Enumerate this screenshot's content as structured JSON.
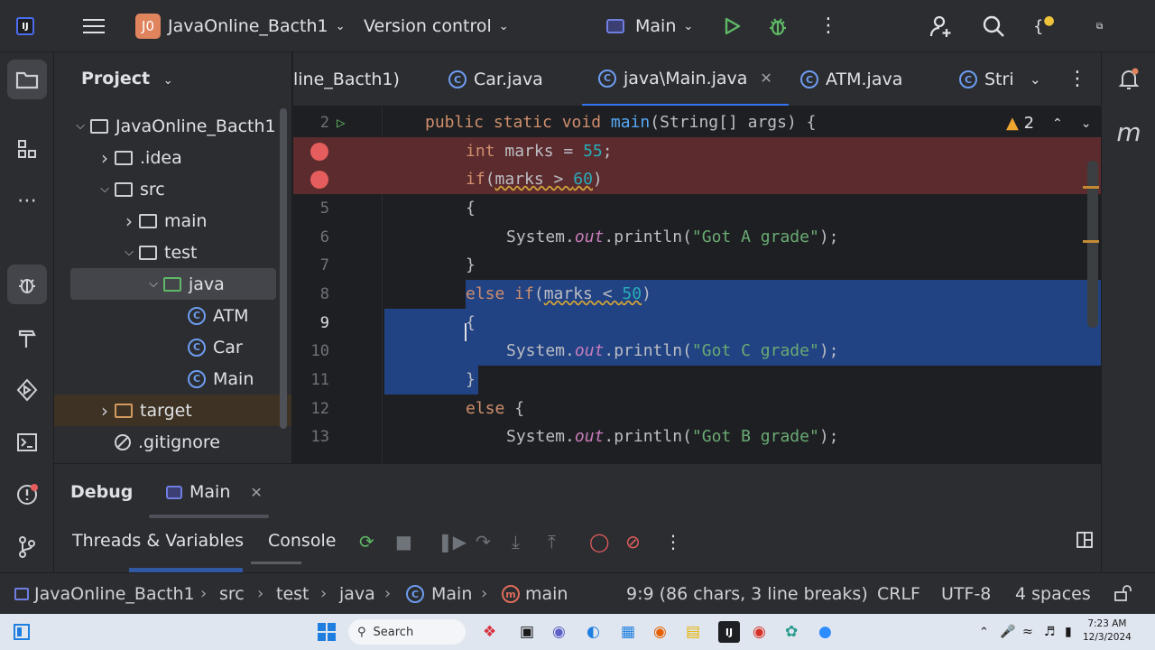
{
  "titlebar": {
    "app_icon_label": "IJ",
    "project_badge": "J0",
    "project_name": "JavaOnline_Bacth1",
    "version_control": "Version control",
    "run_config": "Main"
  },
  "project_panel": {
    "title": "Project",
    "tree": [
      {
        "label": "JavaOnline_Bacth1",
        "type": "folder-root",
        "expanded": true,
        "indent": 0
      },
      {
        "label": ".idea",
        "type": "folder",
        "expanded": false,
        "indent": 1
      },
      {
        "label": "src",
        "type": "folder",
        "expanded": true,
        "indent": 1
      },
      {
        "label": "main",
        "type": "folder",
        "expanded": false,
        "indent": 2
      },
      {
        "label": "test",
        "type": "folder",
        "expanded": true,
        "indent": 2
      },
      {
        "label": "java",
        "type": "folder-green",
        "expanded": true,
        "indent": 3,
        "selected": true
      },
      {
        "label": "ATM",
        "type": "class",
        "indent": 4
      },
      {
        "label": "Car",
        "type": "class",
        "indent": 4
      },
      {
        "label": "Main",
        "type": "class",
        "indent": 4
      },
      {
        "label": "target",
        "type": "folder-orange",
        "expanded": false,
        "indent": 1
      },
      {
        "label": ".gitignore",
        "type": "ignore",
        "indent": 1
      }
    ]
  },
  "tabs": [
    {
      "label": "line_Bacth1)",
      "icon": "none"
    },
    {
      "label": "Car.java",
      "icon": "class-icon"
    },
    {
      "label": "java\\Main.java",
      "icon": "class-icon",
      "active": true
    },
    {
      "label": "ATM.java",
      "icon": "class-icon"
    },
    {
      "label": "Stri",
      "icon": "class-icon"
    }
  ],
  "editor": {
    "warnings_count": "2",
    "line_numbers": [
      "2",
      "",
      "",
      "5",
      "6",
      "7",
      "8",
      "9",
      "10",
      "11",
      "12",
      "13"
    ]
  },
  "debug": {
    "title": "Debug",
    "session_tab": "Main",
    "threads_tab": "Threads & Variables",
    "console_tab": "Console"
  },
  "status": {
    "crumbs": [
      "JavaOnline_Bacth1",
      "src",
      "test",
      "java",
      "Main",
      "main"
    ],
    "position": "9:9 (86 chars, 3 line breaks)",
    "line_sep": "CRLF",
    "encoding": "UTF-8",
    "indent": "4 spaces"
  },
  "taskbar": {
    "search_placeholder": "Search",
    "time": "7:23 AM",
    "date": "12/3/2024"
  }
}
